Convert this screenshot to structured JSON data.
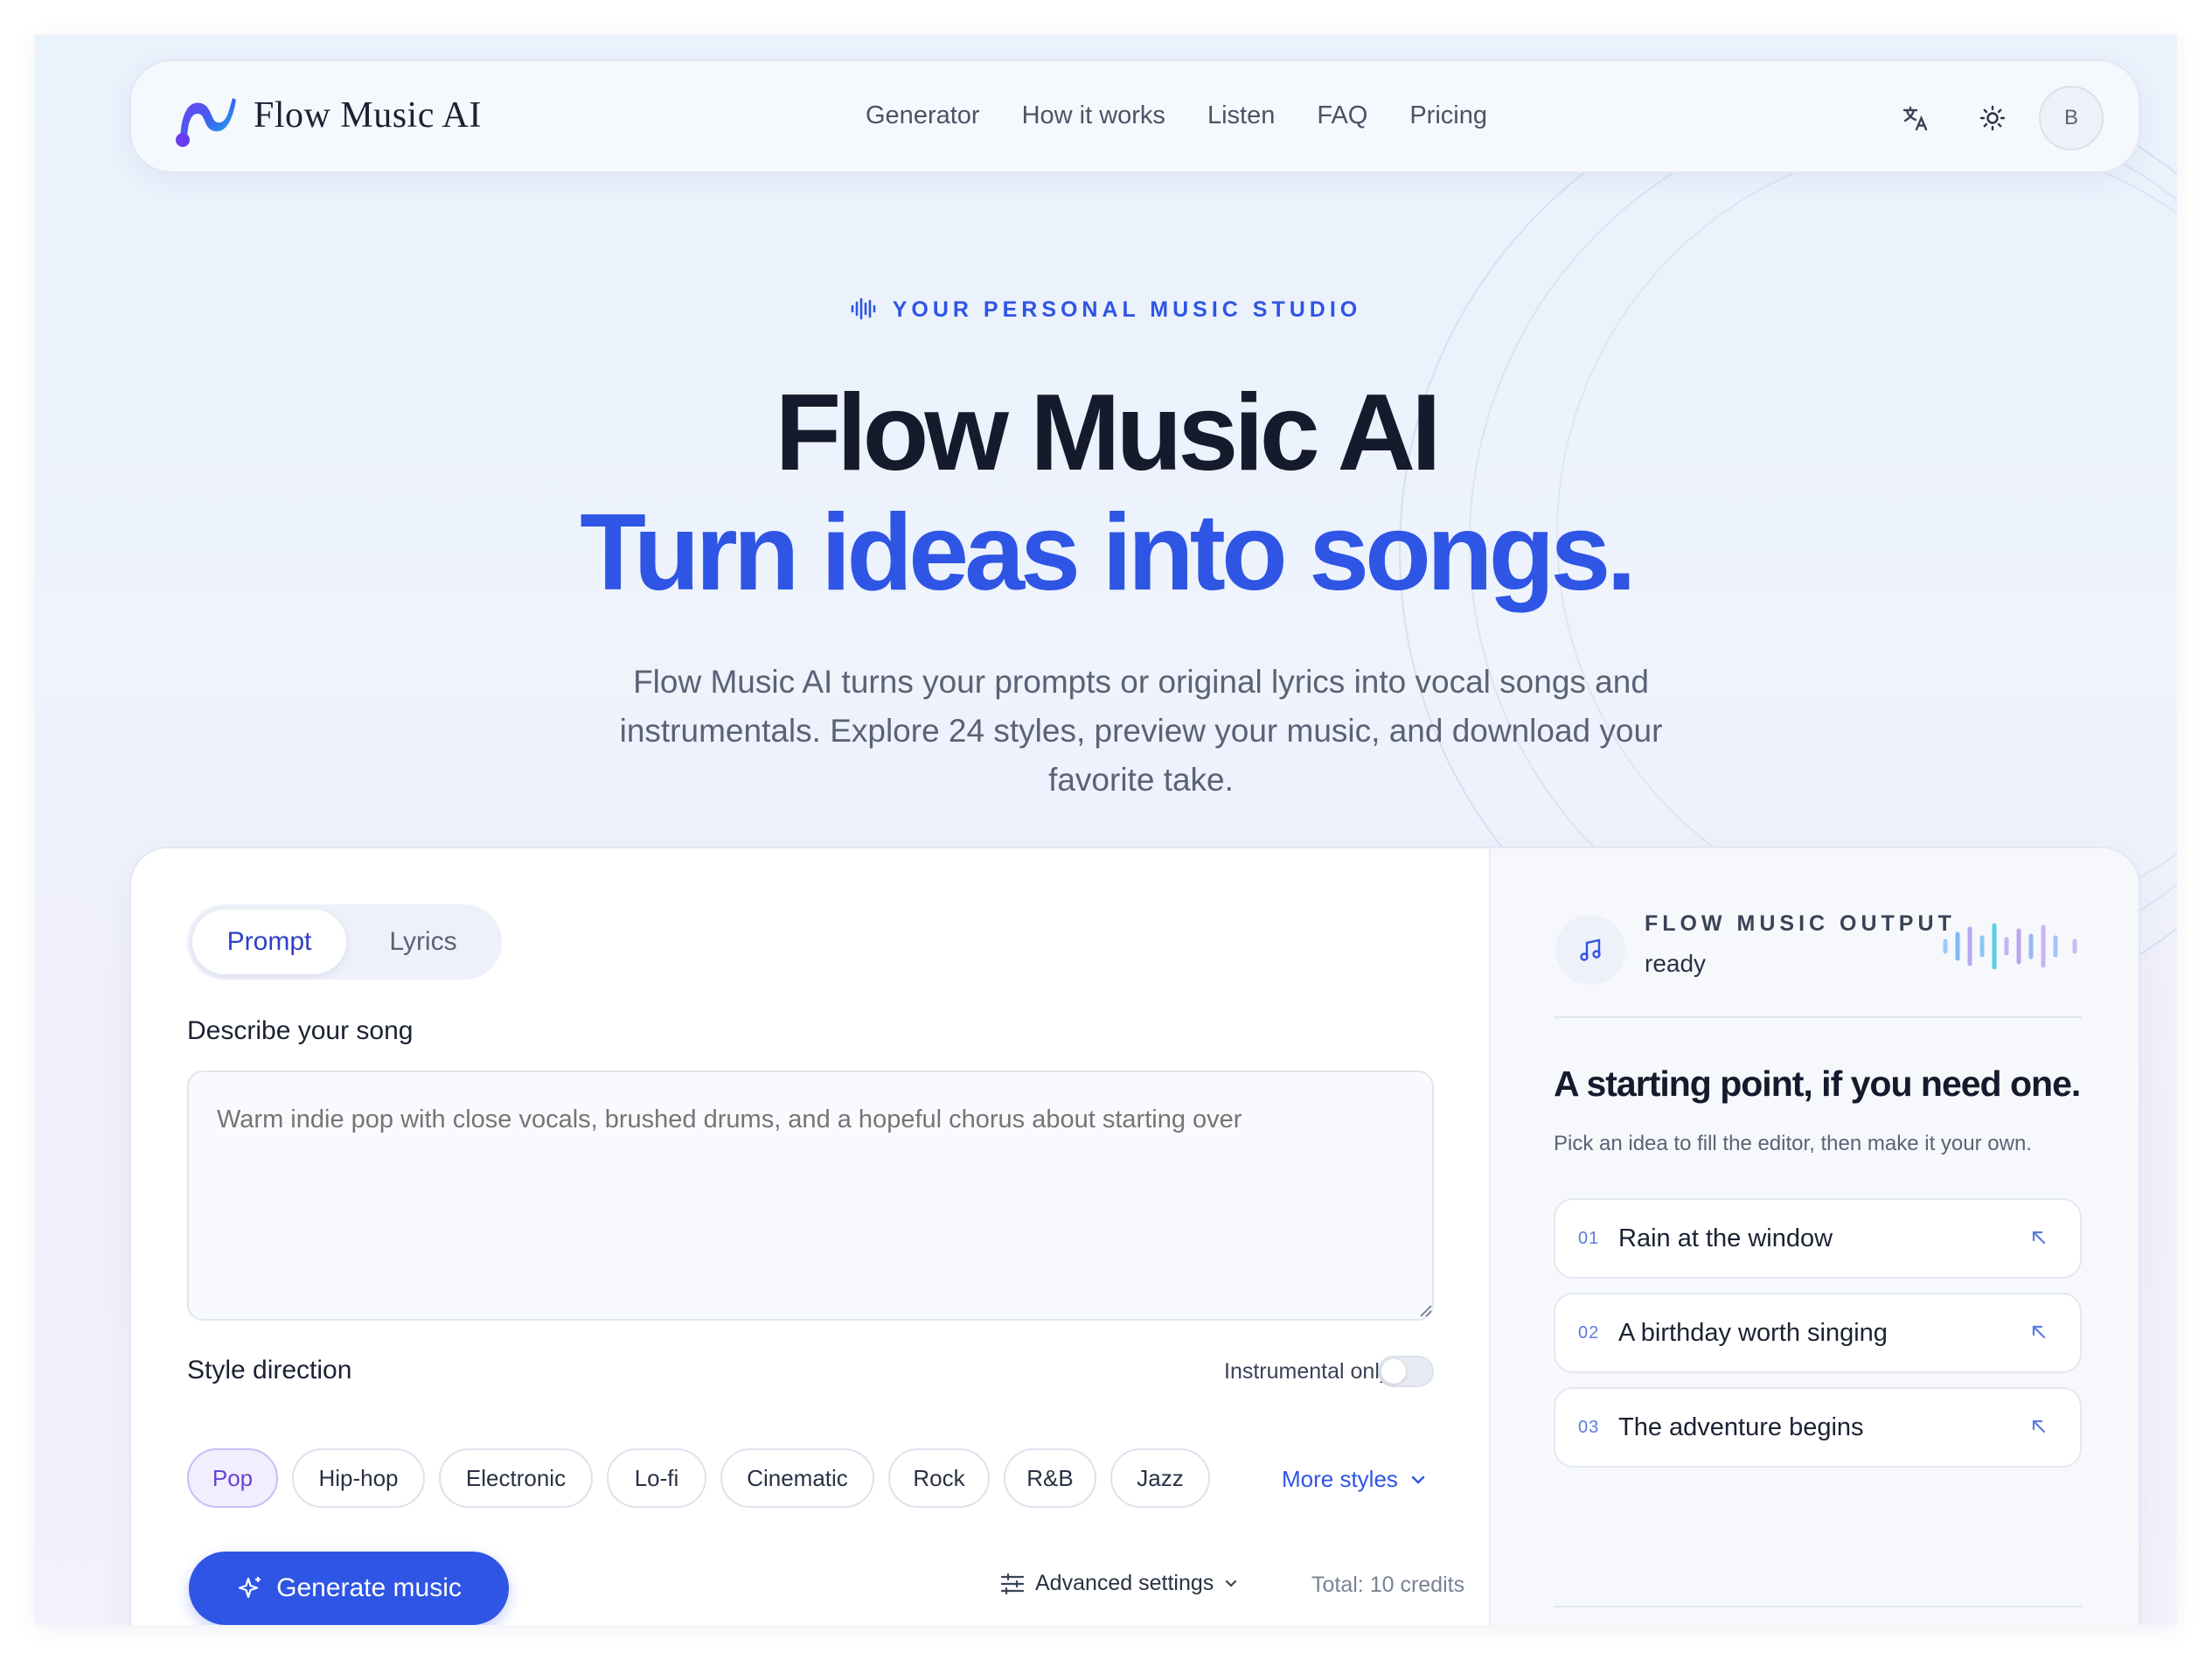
{
  "nav": {
    "brand": "Flow Music AI",
    "links": [
      "Generator",
      "How it works",
      "Listen",
      "FAQ",
      "Pricing"
    ],
    "avatar_initial": "B",
    "icons": [
      "translate-icon",
      "sun-icon"
    ]
  },
  "hero": {
    "eyebrow": "YOUR PERSONAL MUSIC STUDIO",
    "title": "Flow Music AI",
    "title_accent": "Turn ideas into songs.",
    "subtitle": "Flow Music AI turns your prompts or original lyrics into vocal songs and instrumentals. Explore 24 styles, preview your music, and download your favorite take."
  },
  "editor": {
    "tabs": [
      "Prompt",
      "Lyrics"
    ],
    "active_tab": "Prompt",
    "describe_label": "Describe your song",
    "prompt_placeholder": "Warm indie pop with close vocals, brushed drums, and a hopeful chorus about starting over",
    "style_label": "Style direction",
    "instrumental_label": "Instrumental only",
    "instrumental_on": false,
    "styles": [
      "Pop",
      "Hip-hop",
      "Electronic",
      "Lo-fi",
      "Cinematic",
      "Rock",
      "R&B",
      "Jazz"
    ],
    "selected_style": "Pop",
    "more_styles": "More styles",
    "generate_label": "Generate music",
    "advanced_label": "Advanced settings",
    "credits": "Total: 10 credits"
  },
  "output": {
    "title": "FLOW MUSIC OUTPUT",
    "status": "ready",
    "starting_title": "A starting point, if you need one.",
    "starting_sub": "Pick an idea to fill the editor, then make it your own.",
    "ideas": [
      {
        "num": "01",
        "text": "Rain at the window"
      },
      {
        "num": "02",
        "text": "A birthday worth singing"
      },
      {
        "num": "03",
        "text": "The adventure begins"
      }
    ]
  },
  "colors": {
    "accent": "#2f55e4",
    "selected_chip": "#6a43d6"
  }
}
